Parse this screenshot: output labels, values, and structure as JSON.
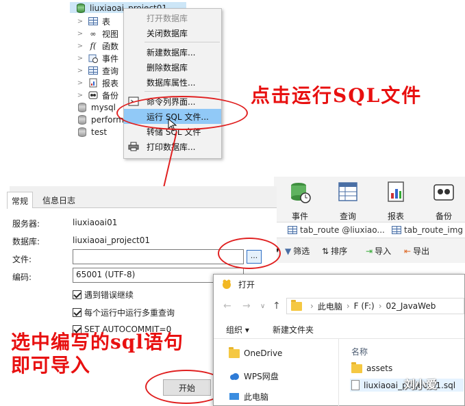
{
  "tree": {
    "connection": "liuxiaoai_project01",
    "items": [
      {
        "label": "表",
        "icon": "table-icon"
      },
      {
        "label": "视图",
        "icon": "view-icon"
      },
      {
        "label": "函数",
        "icon": "function-icon"
      },
      {
        "label": "事件",
        "icon": "event-icon"
      },
      {
        "label": "查询",
        "icon": "query-icon"
      },
      {
        "label": "报表",
        "icon": "report-icon"
      },
      {
        "label": "备份",
        "icon": "backup-icon"
      }
    ],
    "databases": [
      "mysql",
      "perform",
      "test"
    ]
  },
  "context_menu": {
    "items": [
      {
        "label": "打开数据库",
        "disabled": true
      },
      {
        "label": "关闭数据库"
      },
      {
        "label": "新建数据库..."
      },
      {
        "label": "删除数据库"
      },
      {
        "label": "数据库属性..."
      },
      {
        "label": "命令列界面..."
      },
      {
        "label": "运行 SQL 文件...",
        "highlighted": true
      },
      {
        "label": "转储 SQL 文件"
      },
      {
        "label": "打印数据库..."
      }
    ]
  },
  "annotations": {
    "run_sql": "点击运行SQL文件",
    "select_line1": "选中编写的sql语句",
    "select_line2": "即可导入"
  },
  "dialog": {
    "tabs": [
      "常规",
      "信息日志"
    ],
    "server_label": "服务器:",
    "server_value": "liuxiaoai01",
    "database_label": "数据库:",
    "database_value": "liuxiaoai_project01",
    "file_label": "文件:",
    "file_value": "",
    "browse_label": "...",
    "encoding_label": "编码:",
    "encoding_value": "65001 (UTF-8)",
    "options": [
      {
        "label": "遇到错误继续",
        "checked": true
      },
      {
        "label": "每个运行中运行多重查询",
        "checked": true
      },
      {
        "label": "SET AUTOCOMMIT=0",
        "checked": true
      }
    ],
    "start_label": "开始"
  },
  "toolbar": {
    "buttons": [
      {
        "label": "事件",
        "icon": "event-icon"
      },
      {
        "label": "查询",
        "icon": "query-icon"
      },
      {
        "label": "报表",
        "icon": "report-icon"
      },
      {
        "label": "备份",
        "icon": "backup-icon"
      }
    ],
    "tabs": [
      "tab_route @liuxiao...",
      "tab_route_img"
    ],
    "actions": [
      "筛选",
      "排序",
      "导入",
      "导出"
    ]
  },
  "open_dialog": {
    "title": "打开",
    "path": [
      "此电脑",
      "F (F:)",
      "02_JavaWeb"
    ],
    "organize": "组织 ▾",
    "new_folder": "新建文件夹",
    "nav_items": [
      "OneDrive",
      "WPS网盘",
      "此电脑"
    ],
    "column_name": "名称",
    "files": [
      {
        "name": "assets",
        "type": "folder"
      },
      {
        "name": "liuxiaoai_project01.sql",
        "type": "file"
      }
    ]
  },
  "watermark": "刘小爱",
  "colors": {
    "annotation": "#e81010",
    "highlight": "#91c9f7",
    "selection": "#cde6f7"
  }
}
